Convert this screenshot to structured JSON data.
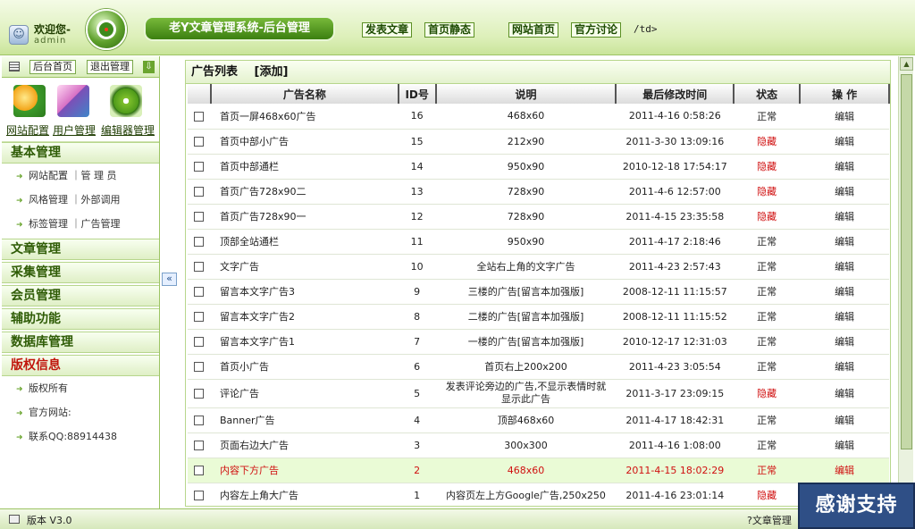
{
  "header": {
    "welcome": "欢迎您-",
    "username": "admin",
    "title": "老Y文章管理系统-后台管理",
    "links": [
      "发表文章",
      "首页静态",
      "网站首页",
      "官方讨论"
    ],
    "stray_text": "/td>"
  },
  "sidebar": {
    "toolbar": {
      "home": "后台首页",
      "logout": "退出管理"
    },
    "quick": [
      {
        "label": "网站配置",
        "icon": "gears-icon"
      },
      {
        "label": "用户管理",
        "icon": "users-icon"
      },
      {
        "label": "编辑器管理",
        "icon": "editor-icon"
      }
    ],
    "sections": [
      {
        "title": "基本管理",
        "items": [
          "网站配置 ｜管 理 员",
          "风格管理 ｜外部调用",
          "标签管理 ｜广告管理"
        ]
      },
      {
        "title": "文章管理",
        "items": []
      },
      {
        "title": "采集管理",
        "items": []
      },
      {
        "title": "会员管理",
        "items": []
      },
      {
        "title": "辅助功能",
        "items": []
      },
      {
        "title": "数据库管理",
        "items": []
      },
      {
        "title": "版权信息",
        "items": [
          "版权所有",
          "官方网站:",
          "联系QQ:88914438"
        ]
      }
    ]
  },
  "main": {
    "title": "广告列表",
    "add": "[添加]",
    "columns": [
      "广告名称",
      "ID号",
      "说明",
      "最后修改时间",
      "状态",
      "操 作"
    ],
    "rows": [
      {
        "name": "首页一屏468x60广告",
        "id": "16",
        "desc": "468x60",
        "time": "2011-4-16 0:58:26",
        "status": "正常",
        "action": "编辑"
      },
      {
        "name": "首页中部小广告",
        "id": "15",
        "desc": "212x90",
        "time": "2011-3-30 13:09:16",
        "status": "隐藏",
        "action": "编辑"
      },
      {
        "name": "首页中部通栏",
        "id": "14",
        "desc": "950x90",
        "time": "2010-12-18 17:54:17",
        "status": "隐藏",
        "action": "编辑"
      },
      {
        "name": "首页广告728x90二",
        "id": "13",
        "desc": "728x90",
        "time": "2011-4-6 12:57:00",
        "status": "隐藏",
        "action": "编辑"
      },
      {
        "name": "首页广告728x90一",
        "id": "12",
        "desc": "728x90",
        "time": "2011-4-15 23:35:58",
        "status": "隐藏",
        "action": "编辑"
      },
      {
        "name": "顶部全站通栏",
        "id": "11",
        "desc": "950x90",
        "time": "2011-4-17 2:18:46",
        "status": "正常",
        "action": "编辑"
      },
      {
        "name": "文字广告",
        "id": "10",
        "desc": "全站右上角的文字广告",
        "time": "2011-4-23 2:57:43",
        "status": "正常",
        "action": "编辑"
      },
      {
        "name": "留言本文字广告3",
        "id": "9",
        "desc": "三楼的广告[留言本加强版]",
        "time": "2008-12-11 11:15:57",
        "status": "正常",
        "action": "编辑"
      },
      {
        "name": "留言本文字广告2",
        "id": "8",
        "desc": "二楼的广告[留言本加强版]",
        "time": "2008-12-11 11:15:52",
        "status": "正常",
        "action": "编辑"
      },
      {
        "name": "留言本文字广告1",
        "id": "7",
        "desc": "一楼的广告[留言本加强版]",
        "time": "2010-12-17 12:31:03",
        "status": "正常",
        "action": "编辑"
      },
      {
        "name": "首页小广告",
        "id": "6",
        "desc": "首页右上200x200",
        "time": "2011-4-23 3:05:54",
        "status": "正常",
        "action": "编辑"
      },
      {
        "name": "评论广告",
        "id": "5",
        "desc": "发表评论旁边的广告,不显示表情时就显示此广告",
        "time": "2011-3-17 23:09:15",
        "status": "隐藏",
        "action": "编辑"
      },
      {
        "name": "Banner广告",
        "id": "4",
        "desc": "顶部468x60",
        "time": "2011-4-17 18:42:31",
        "status": "正常",
        "action": "编辑"
      },
      {
        "name": "页面右边大广告",
        "id": "3",
        "desc": "300x300",
        "time": "2011-4-16 1:08:00",
        "status": "正常",
        "action": "编辑"
      },
      {
        "name": "内容下方广告",
        "id": "2",
        "desc": "468x60",
        "time": "2011-4-15 18:02:29",
        "status": "正常",
        "action": "编辑"
      },
      {
        "name": "内容左上角大广告",
        "id": "1",
        "desc": "内容页左上方Google广告,250x250",
        "time": "2011-4-16 23:01:14",
        "status": "隐藏",
        "action": "编辑"
      }
    ]
  },
  "footer": {
    "version": "版本 V3.0",
    "help": "文章管理"
  },
  "overlay": {
    "thanks": "感谢支持"
  },
  "colors": {
    "accent": "#3b7f10",
    "hidden_status": "#d01010",
    "highlight_row": "#eafbd6"
  }
}
